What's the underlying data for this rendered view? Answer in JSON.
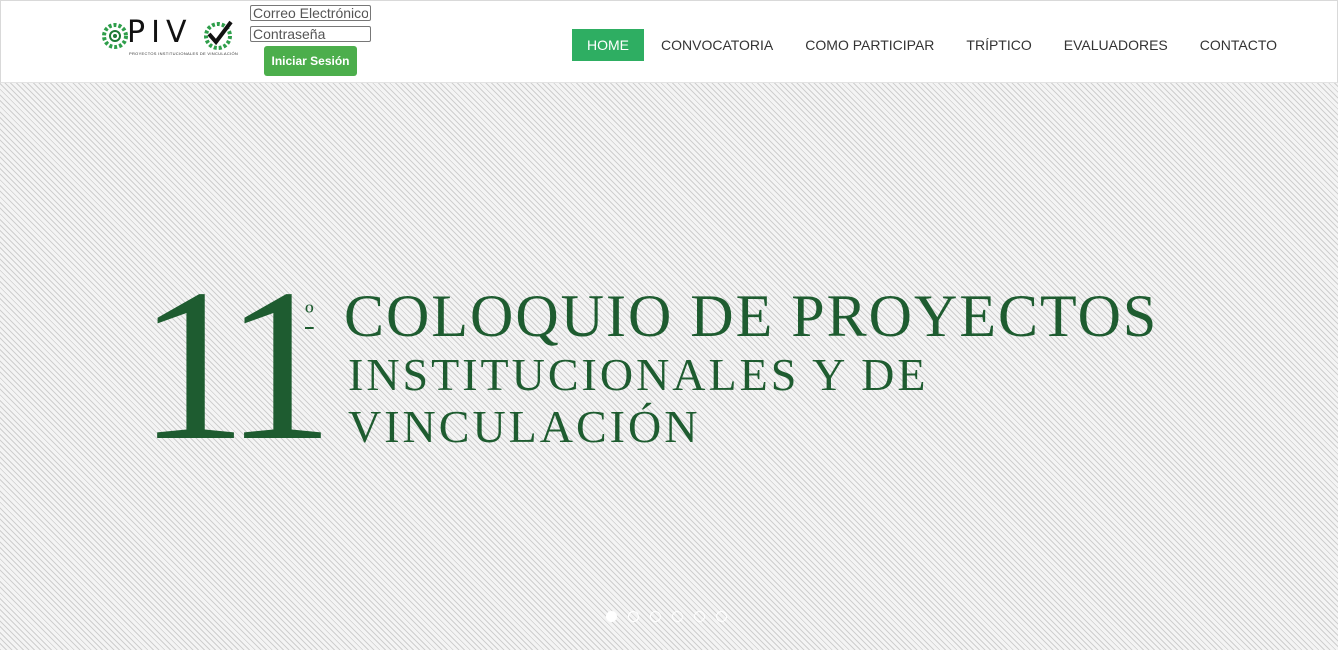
{
  "brand": {
    "logo_text": "PIV",
    "tagline": "PROYECTOS INSTITUCIONALES DE VINCULACIÓN",
    "accent_color": "#2eae62"
  },
  "login": {
    "email_placeholder": "Correo Electrónico",
    "password_placeholder": "Contraseña",
    "submit_label": "Iniciar Sesión"
  },
  "nav": {
    "items": [
      {
        "label": "HOME",
        "active": true
      },
      {
        "label": "CONVOCATORIA",
        "active": false
      },
      {
        "label": "COMO PARTICIPAR",
        "active": false
      },
      {
        "label": "TRÍPTICO",
        "active": false
      },
      {
        "label": "EVALUADORES",
        "active": false
      },
      {
        "label": "CONTACTO",
        "active": false
      }
    ]
  },
  "hero": {
    "number": "11",
    "ordinal": "º",
    "line1": "COLOQUIO DE PROYECTOS",
    "line2": "INSTITUCIONALES Y DE",
    "line3": "VINCULACIÓN",
    "text_color": "#1e5c30"
  },
  "slider": {
    "slide_count": 6,
    "active_index": 0
  }
}
